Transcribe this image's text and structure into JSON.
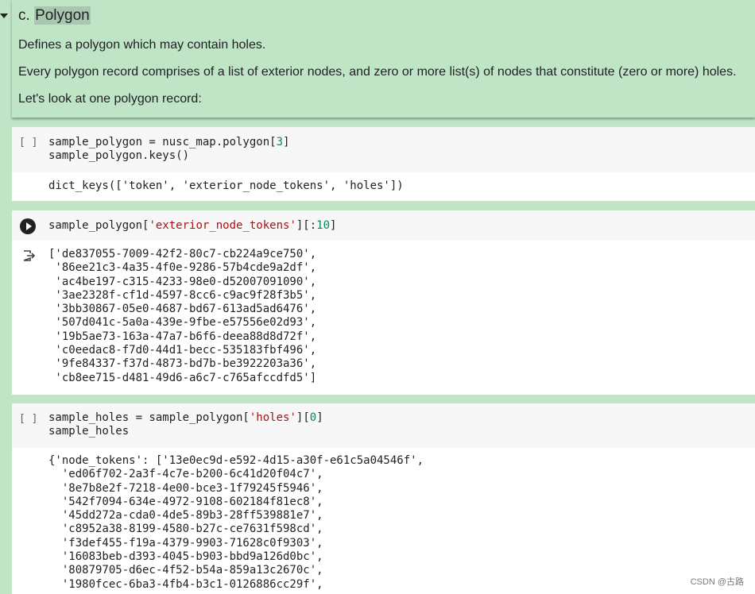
{
  "markdown": {
    "title_prefix": "c. ",
    "title_highlight": "Polygon",
    "paragraphs": [
      "Defines a polygon which may contain holes.",
      "Every polygon record comprises of a list of exterior nodes, and zero or more list(s) of nodes that constitute (zero or more) holes.",
      "Let's look at one polygon record:"
    ]
  },
  "cells": [
    {
      "brackets": "[ ]",
      "code_lines": [
        [
          "sample_polygon = nusc_map.polygon[",
          "3",
          "]"
        ],
        [
          "sample_polygon.keys()"
        ]
      ],
      "output_lines": [
        "dict_keys(['token', 'exterior_node_tokens', 'holes'])"
      ]
    },
    {
      "code_parts": [
        "sample_polygon[",
        "'exterior_node_tokens'",
        "][:",
        "10",
        "]"
      ],
      "output_lines": [
        "['de837055-7009-42f2-80c7-cb224a9ce750',",
        " '86ee21c3-4a35-4f0e-9286-57b4cde9a2df',",
        " 'ac4be197-c315-4233-98e0-d52007091090',",
        " '3ae2328f-cf1d-4597-8cc6-c9ac9f28f3b5',",
        " '3bb30867-05e0-4687-bd67-613ad5ad6476',",
        " '507d041c-5a0a-439e-9fbe-e57556e02d93',",
        " '19b5ae73-163a-47a7-b6f6-deea88d8d72f',",
        " 'c0eedac8-f7d0-44d1-becc-535183fbf496',",
        " '9fe84337-f37d-4873-bd7b-be3922203a36',",
        " 'cb8ee715-d481-49d6-a6c7-c765afccdfd5']"
      ]
    },
    {
      "brackets": "[ ]",
      "code_line1_parts": [
        "sample_holes = sample_polygon[",
        "'holes'",
        "][",
        "0",
        "]"
      ],
      "code_line2": "sample_holes",
      "output_lines": [
        "{'node_tokens': ['13e0ec9d-e592-4d15-a30f-e61c5a04546f',",
        "  'ed06f702-2a3f-4c7e-b200-6c41d20f04c7',",
        "  '8e7b8e2f-7218-4e00-bce3-1f79245f5946',",
        "  '542f7094-634e-4972-9108-602184f81ec8',",
        "  '45dd272a-cda0-4de5-89b3-28ff539881e7',",
        "  'c8952a38-8199-4580-b27c-ce7631f598cd',",
        "  'f3def455-f19a-4379-9903-71628c0f9303',",
        "  '16083beb-d393-4045-b903-bbd9a126d0bc',",
        "  '80879705-d6ec-4f52-b54a-859a13c2670c',",
        "  '1980fcec-6ba3-4fb4-b3c1-0126886cc29f',"
      ]
    }
  ],
  "watermark": "CSDN @古路"
}
